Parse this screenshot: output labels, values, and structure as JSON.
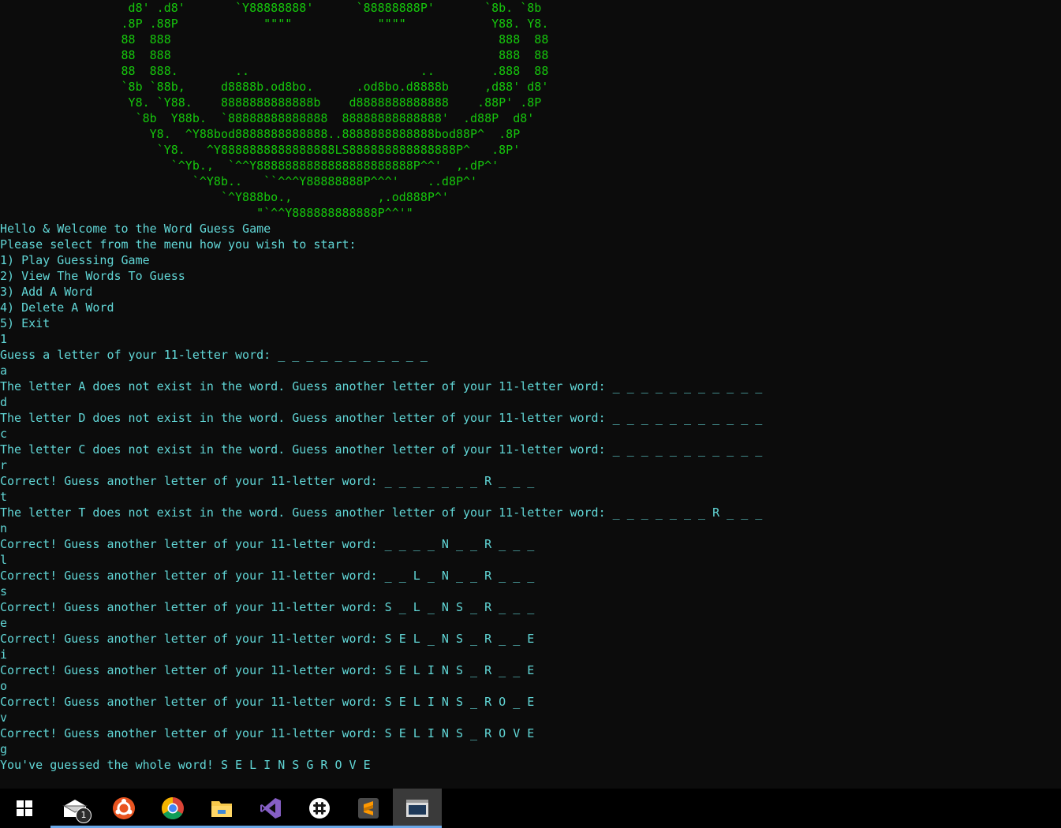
{
  "ascii_art": [
    "                  d8' .d8'       `Y88888888'      `88888888P'       `8b. `8b",
    "                 .8P .88P            \"\"\"\"            \"\"\"\"            Y88. Y8.",
    "                 88  888                                              888  88",
    "                 88  888                                              888  88",
    "                 88  888.        ..                        ..        .888  88",
    "                 `8b `88b,     d8888b.od8bo.      .od8bo.d8888b     ,d88' d8'",
    "                  Y8. `Y88.    8888888888888b    d8888888888888    .88P' .8P",
    "                   `8b  Y88b.  `88888888888888  88888888888888'  .d88P  d8'",
    "                     Y8.  ^Y88bod8888888888888..8888888888888bod88P^  .8P",
    "                      `Y8.   ^Y8888888888888888LS888888888888888P^   .8P'",
    "                        `^Yb.,  `^^Y8888888888888888888888P^^'  ,.dP^'",
    "                           `^Y8b..   ``^^^Y88888888P^^^'    ..d8P^'",
    "                               `^Y888bo.,            ,.od888P^'",
    "                                    \"`^^Y888888888888P^^'\""
  ],
  "console_lines": [
    "Hello & Welcome to the Word Guess Game",
    "Please select from the menu how you wish to start:",
    "1) Play Guessing Game",
    "2) View The Words To Guess",
    "3) Add A Word",
    "4) Delete A Word",
    "5) Exit",
    "1",
    "Guess a letter of your 11-letter word: _ _ _ _ _ _ _ _ _ _ _",
    "a",
    "The letter A does not exist in the word. Guess another letter of your 11-letter word: _ _ _ _ _ _ _ _ _ _ _",
    "d",
    "The letter D does not exist in the word. Guess another letter of your 11-letter word: _ _ _ _ _ _ _ _ _ _ _",
    "c",
    "The letter C does not exist in the word. Guess another letter of your 11-letter word: _ _ _ _ _ _ _ _ _ _ _",
    "r",
    "Correct! Guess another letter of your 11-letter word: _ _ _ _ _ _ _ R _ _ _",
    "t",
    "The letter T does not exist in the word. Guess another letter of your 11-letter word: _ _ _ _ _ _ _ R _ _ _",
    "n",
    "Correct! Guess another letter of your 11-letter word: _ _ _ _ N _ _ R _ _ _",
    "l",
    "Correct! Guess another letter of your 11-letter word: _ _ L _ N _ _ R _ _ _",
    "s",
    "Correct! Guess another letter of your 11-letter word: S _ L _ N S _ R _ _ _",
    "e",
    "Correct! Guess another letter of your 11-letter word: S E L _ N S _ R _ _ E",
    "i",
    "Correct! Guess another letter of your 11-letter word: S E L I N S _ R _ _ E",
    "o",
    "Correct! Guess another letter of your 11-letter word: S E L I N S _ R O _ E",
    "v",
    "Correct! Guess another letter of your 11-letter word: S E L I N S _ R O V E",
    "g",
    "You've guessed the whole word! S E L I N S G R O V E"
  ],
  "colors": {
    "background": "#0c0c0c",
    "art_text": "#16c60c",
    "console_text": "#61d6d6",
    "taskbar": "#000000",
    "active_indicator": "#6aa8e8"
  },
  "taskbar": {
    "items": [
      {
        "icon": "windows-start-icon",
        "badge": null,
        "indicator": false,
        "active": false
      },
      {
        "icon": "mail-icon",
        "badge": "1",
        "indicator": true,
        "active": false
      },
      {
        "icon": "ubuntu-icon",
        "badge": null,
        "indicator": true,
        "active": false
      },
      {
        "icon": "chrome-icon",
        "badge": null,
        "indicator": true,
        "active": false
      },
      {
        "icon": "file-explorer-icon",
        "badge": null,
        "indicator": true,
        "active": false
      },
      {
        "icon": "visual-studio-icon",
        "badge": null,
        "indicator": true,
        "active": false
      },
      {
        "icon": "slack-icon",
        "badge": null,
        "indicator": true,
        "active": false
      },
      {
        "icon": "sublime-text-icon",
        "badge": null,
        "indicator": true,
        "active": false
      },
      {
        "icon": "console-window-icon",
        "badge": null,
        "indicator": true,
        "active": true
      }
    ]
  }
}
